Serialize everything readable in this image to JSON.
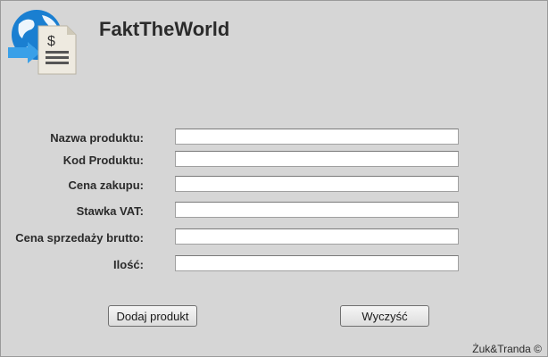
{
  "app": {
    "title": "FaktTheWorld",
    "logo_icon": "globe-invoice-icon"
  },
  "form": {
    "fields": [
      {
        "label": "Nazwa produktu:",
        "value": ""
      },
      {
        "label": "Kod Produktu:",
        "value": ""
      },
      {
        "label": "Cena zakupu:",
        "value": ""
      },
      {
        "label": "Stawka VAT:",
        "value": ""
      },
      {
        "label": "Cena sprzedaży brutto:",
        "value": ""
      },
      {
        "label": "Ilość:",
        "value": ""
      }
    ]
  },
  "buttons": {
    "add_label": "Dodaj produkt",
    "clear_label": "Wyczyść"
  },
  "footer": {
    "copyright": "Żuk&Tranda ©"
  },
  "colors": {
    "background": "#d6d6d6",
    "globe_blue": "#1a7fd1",
    "arrow_blue": "#3aa0e8"
  }
}
